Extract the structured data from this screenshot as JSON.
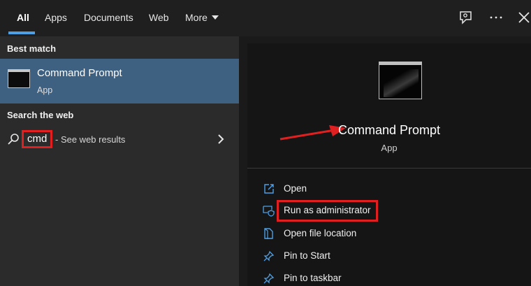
{
  "tabs": [
    {
      "label": "All",
      "active": true
    },
    {
      "label": "Apps"
    },
    {
      "label": "Documents"
    },
    {
      "label": "Web"
    },
    {
      "label": "More"
    }
  ],
  "top_icons": [
    "feedback-icon",
    "more-options-icon",
    "close-icon"
  ],
  "left": {
    "best_match_header": "Best match",
    "best_match": {
      "title": "Command Prompt",
      "subtitle": "App"
    },
    "search_web_header": "Search the web",
    "web_result": {
      "query": "cmd",
      "suffix": "- See web results"
    }
  },
  "right": {
    "app_title": "Command Prompt",
    "app_subtitle": "App",
    "actions": [
      {
        "label": "Open",
        "icon": "open-icon"
      },
      {
        "label": "Run as administrator",
        "icon": "shield-icon"
      },
      {
        "label": "Open file location",
        "icon": "file-location-icon"
      },
      {
        "label": "Pin to Start",
        "icon": "pin-icon"
      },
      {
        "label": "Pin to taskbar",
        "icon": "pin-icon"
      }
    ]
  },
  "colors": {
    "accent": "#4ea0e6",
    "selected": "#3e6081",
    "annotation": "#e02020"
  }
}
